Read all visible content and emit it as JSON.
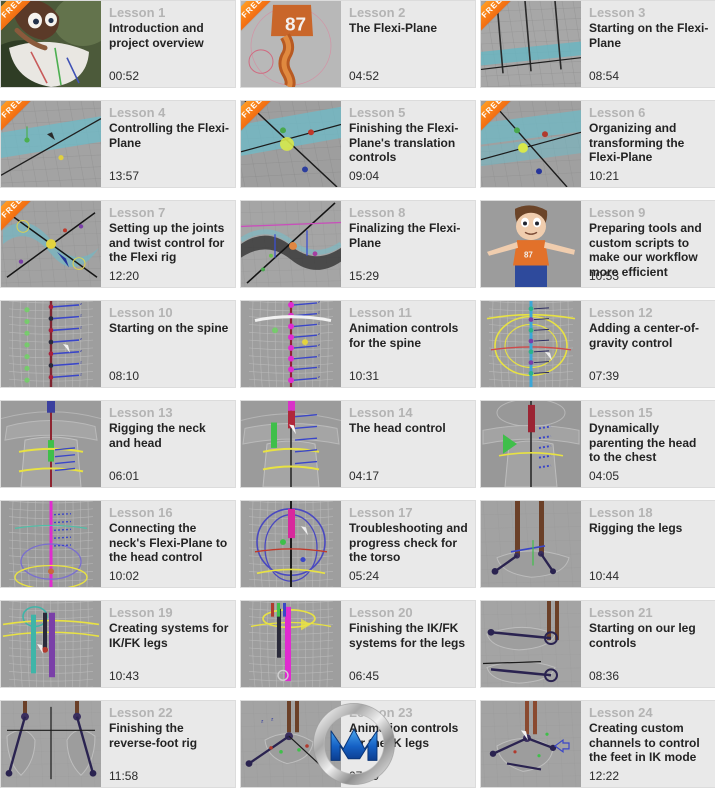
{
  "layout": {
    "columns": 3,
    "rows": 8,
    "background_color": "#ffffff",
    "card_background": "#e9e9e9",
    "lesson_number_color": "#b4b4b4",
    "title_color": "#232323",
    "duration_color": "#2b2b2b",
    "ribbon_color": "#f26c12"
  },
  "badge": {
    "free_label": "FREE"
  },
  "watermark": {
    "name": "vfxmc-logo-watermark",
    "letter": "M"
  },
  "lessons": [
    {
      "number": "Lesson 1",
      "title": "Introduction and project overview",
      "duration": "00:52",
      "free": true,
      "thumb": "photo-boy-with-cloth"
    },
    {
      "number": "Lesson 2",
      "title": "The Flexi-Plane",
      "duration": "04:52",
      "free": true,
      "thumb": "orange-character-bust"
    },
    {
      "number": "Lesson 3",
      "title": "Starting on the Flexi-Plane",
      "duration": "08:54",
      "free": true,
      "thumb": "grid-with-poles"
    },
    {
      "number": "Lesson 4",
      "title": "Controlling the Flexi-Plane",
      "duration": "13:57",
      "free": true,
      "thumb": "cyan-plane-axis"
    },
    {
      "number": "Lesson 5",
      "title": "Finishing the Flexi-Plane's translation controls",
      "duration": "09:04",
      "free": true,
      "thumb": "cyan-plane-handles"
    },
    {
      "number": "Lesson 6",
      "title": "Organizing and transforming the Flexi-Plane",
      "duration": "10:21",
      "free": true,
      "thumb": "cyan-plane-transform"
    },
    {
      "number": "Lesson 7",
      "title": "Setting up the joints and twist control for the Flexi rig",
      "duration": "12:20",
      "free": true,
      "thumb": "twist-joints-rig"
    },
    {
      "number": "Lesson 8",
      "title": "Finalizing the Flexi-Plane",
      "duration": "15:29",
      "free": false,
      "thumb": "dark-ribbon-plane"
    },
    {
      "number": "Lesson 9",
      "title": "Preparing tools and custom scripts to make our workflow more efficient",
      "duration": "10:53",
      "free": false,
      "thumb": "boy-character-tpose"
    },
    {
      "number": "Lesson 10",
      "title": "Starting on the spine",
      "duration": "08:10",
      "free": false,
      "thumb": "spine-wireframe"
    },
    {
      "number": "Lesson 11",
      "title": "Animation controls for the spine",
      "duration": "10:31",
      "free": false,
      "thumb": "spine-magenta-controls"
    },
    {
      "number": "Lesson 12",
      "title": "Adding a center-of-gravity control",
      "duration": "07:39",
      "free": false,
      "thumb": "cog-yellow-circle"
    },
    {
      "number": "Lesson 13",
      "title": "Rigging the neck and head",
      "duration": "06:01",
      "free": false,
      "thumb": "neck-head-rig"
    },
    {
      "number": "Lesson 14",
      "title": "The head control",
      "duration": "04:17",
      "free": false,
      "thumb": "head-control"
    },
    {
      "number": "Lesson 15",
      "title": "Dynamically parenting the head to the chest",
      "duration": "04:05",
      "free": false,
      "thumb": "head-chest-parent"
    },
    {
      "number": "Lesson 16",
      "title": "Connecting the neck's Flexi-Plane to the head control",
      "duration": "10:02",
      "free": false,
      "thumb": "neck-flexi-connect"
    },
    {
      "number": "Lesson 17",
      "title": "Troubleshooting and progress check for the torso",
      "duration": "05:24",
      "free": false,
      "thumb": "torso-progress-check"
    },
    {
      "number": "Lesson 18",
      "title": "Rigging the legs",
      "duration": "10:44",
      "free": false,
      "thumb": "legs-rig"
    },
    {
      "number": "Lesson 19",
      "title": "Creating systems for IK/FK legs",
      "duration": "10:43",
      "free": false,
      "thumb": "ikfk-legs-systems"
    },
    {
      "number": "Lesson 20",
      "title": "Finishing the IK/FK systems for the legs",
      "duration": "06:45",
      "free": false,
      "thumb": "ikfk-legs-finish"
    },
    {
      "number": "Lesson 21",
      "title": "Starting on our leg controls",
      "duration": "08:36",
      "free": false,
      "thumb": "foot-controls"
    },
    {
      "number": "Lesson 22",
      "title": "Finishing the reverse-foot rig",
      "duration": "11:58",
      "free": false,
      "thumb": "reverse-foot-rig"
    },
    {
      "number": "Lesson 23",
      "title": "Animation controls for the IK legs",
      "duration": "07:09",
      "free": false,
      "thumb": "ik-legs-anim-controls"
    },
    {
      "number": "Lesson 24",
      "title": "Creating custom channels to control the feet in IK mode",
      "duration": "12:22",
      "free": false,
      "thumb": "custom-channels-feet"
    }
  ]
}
